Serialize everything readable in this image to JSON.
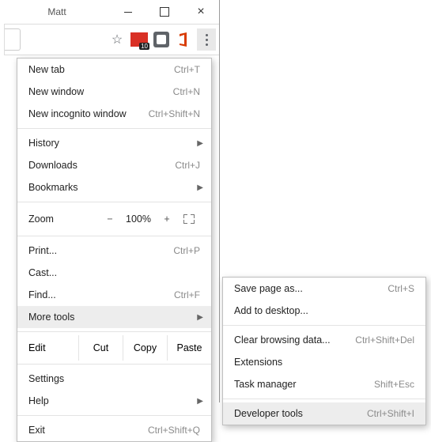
{
  "titlebar": {
    "name": "Matt"
  },
  "toolbar": {
    "badge": "10"
  },
  "menu": {
    "new_tab": "New tab",
    "new_tab_sc": "Ctrl+T",
    "new_window": "New window",
    "new_window_sc": "Ctrl+N",
    "incognito": "New incognito window",
    "incognito_sc": "Ctrl+Shift+N",
    "history": "History",
    "downloads": "Downloads",
    "downloads_sc": "Ctrl+J",
    "bookmarks": "Bookmarks",
    "zoom": "Zoom",
    "zoom_pct": "100%",
    "print": "Print...",
    "print_sc": "Ctrl+P",
    "cast": "Cast...",
    "find": "Find...",
    "find_sc": "Ctrl+F",
    "more_tools": "More tools",
    "edit": "Edit",
    "cut": "Cut",
    "copy": "Copy",
    "paste": "Paste",
    "settings": "Settings",
    "help": "Help",
    "exit": "Exit",
    "exit_sc": "Ctrl+Shift+Q"
  },
  "submenu": {
    "save_as": "Save page as...",
    "save_as_sc": "Ctrl+S",
    "add_desktop": "Add to desktop...",
    "clear_data": "Clear browsing data...",
    "clear_data_sc": "Ctrl+Shift+Del",
    "extensions": "Extensions",
    "task_manager": "Task manager",
    "task_manager_sc": "Shift+Esc",
    "dev_tools": "Developer tools",
    "dev_tools_sc": "Ctrl+Shift+I"
  }
}
